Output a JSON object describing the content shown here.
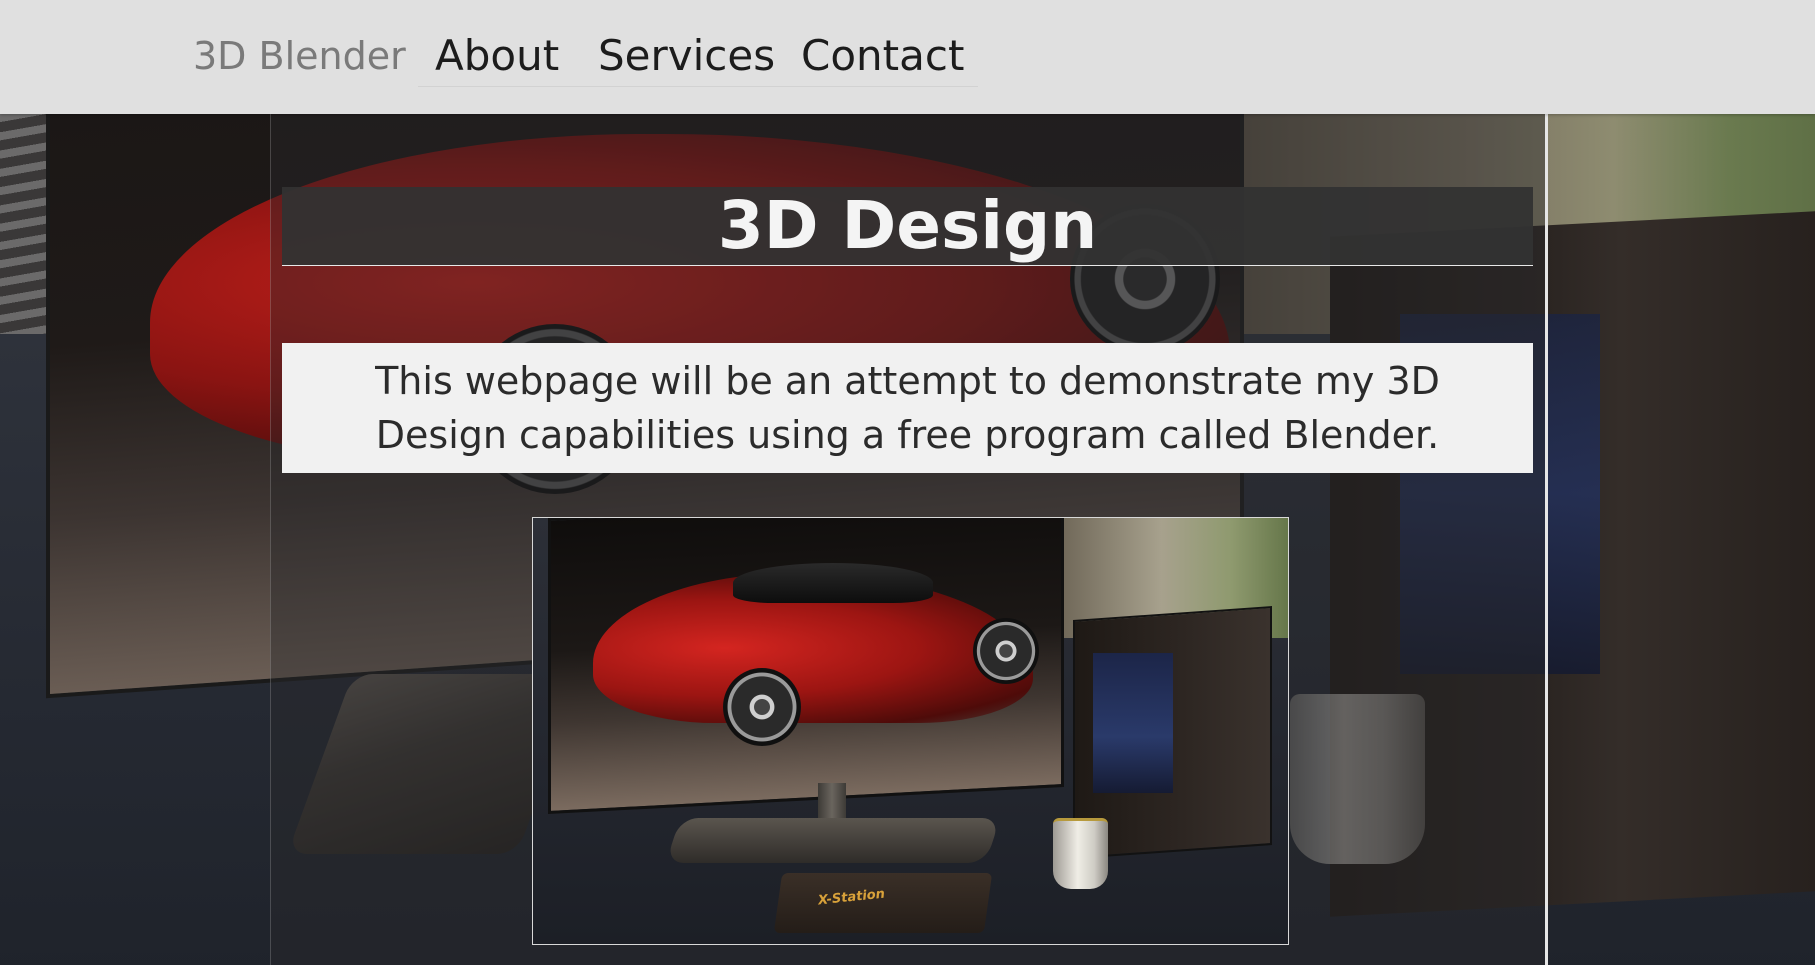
{
  "nav": {
    "brand": "3D Blender",
    "links": [
      {
        "label": "About"
      },
      {
        "label": "Services"
      },
      {
        "label": "Contact"
      }
    ]
  },
  "hero": {
    "title": "3D Design",
    "intro": "This webpage will be an attempt to demonstrate my 3D Design capabilities using a free program called Blender."
  },
  "featured_render": {
    "console_label": "X-Station"
  },
  "colors": {
    "navbar_bg": "#e0e0e0",
    "brand_text": "#7a7a7a",
    "nav_link_text": "#1c1c1c",
    "heading_box_bg": "#323232",
    "heading_text": "#f4f4f4",
    "intro_box_bg": "#f1f1f1",
    "intro_text": "#2b2b2b",
    "car_red": "#c8201b"
  }
}
